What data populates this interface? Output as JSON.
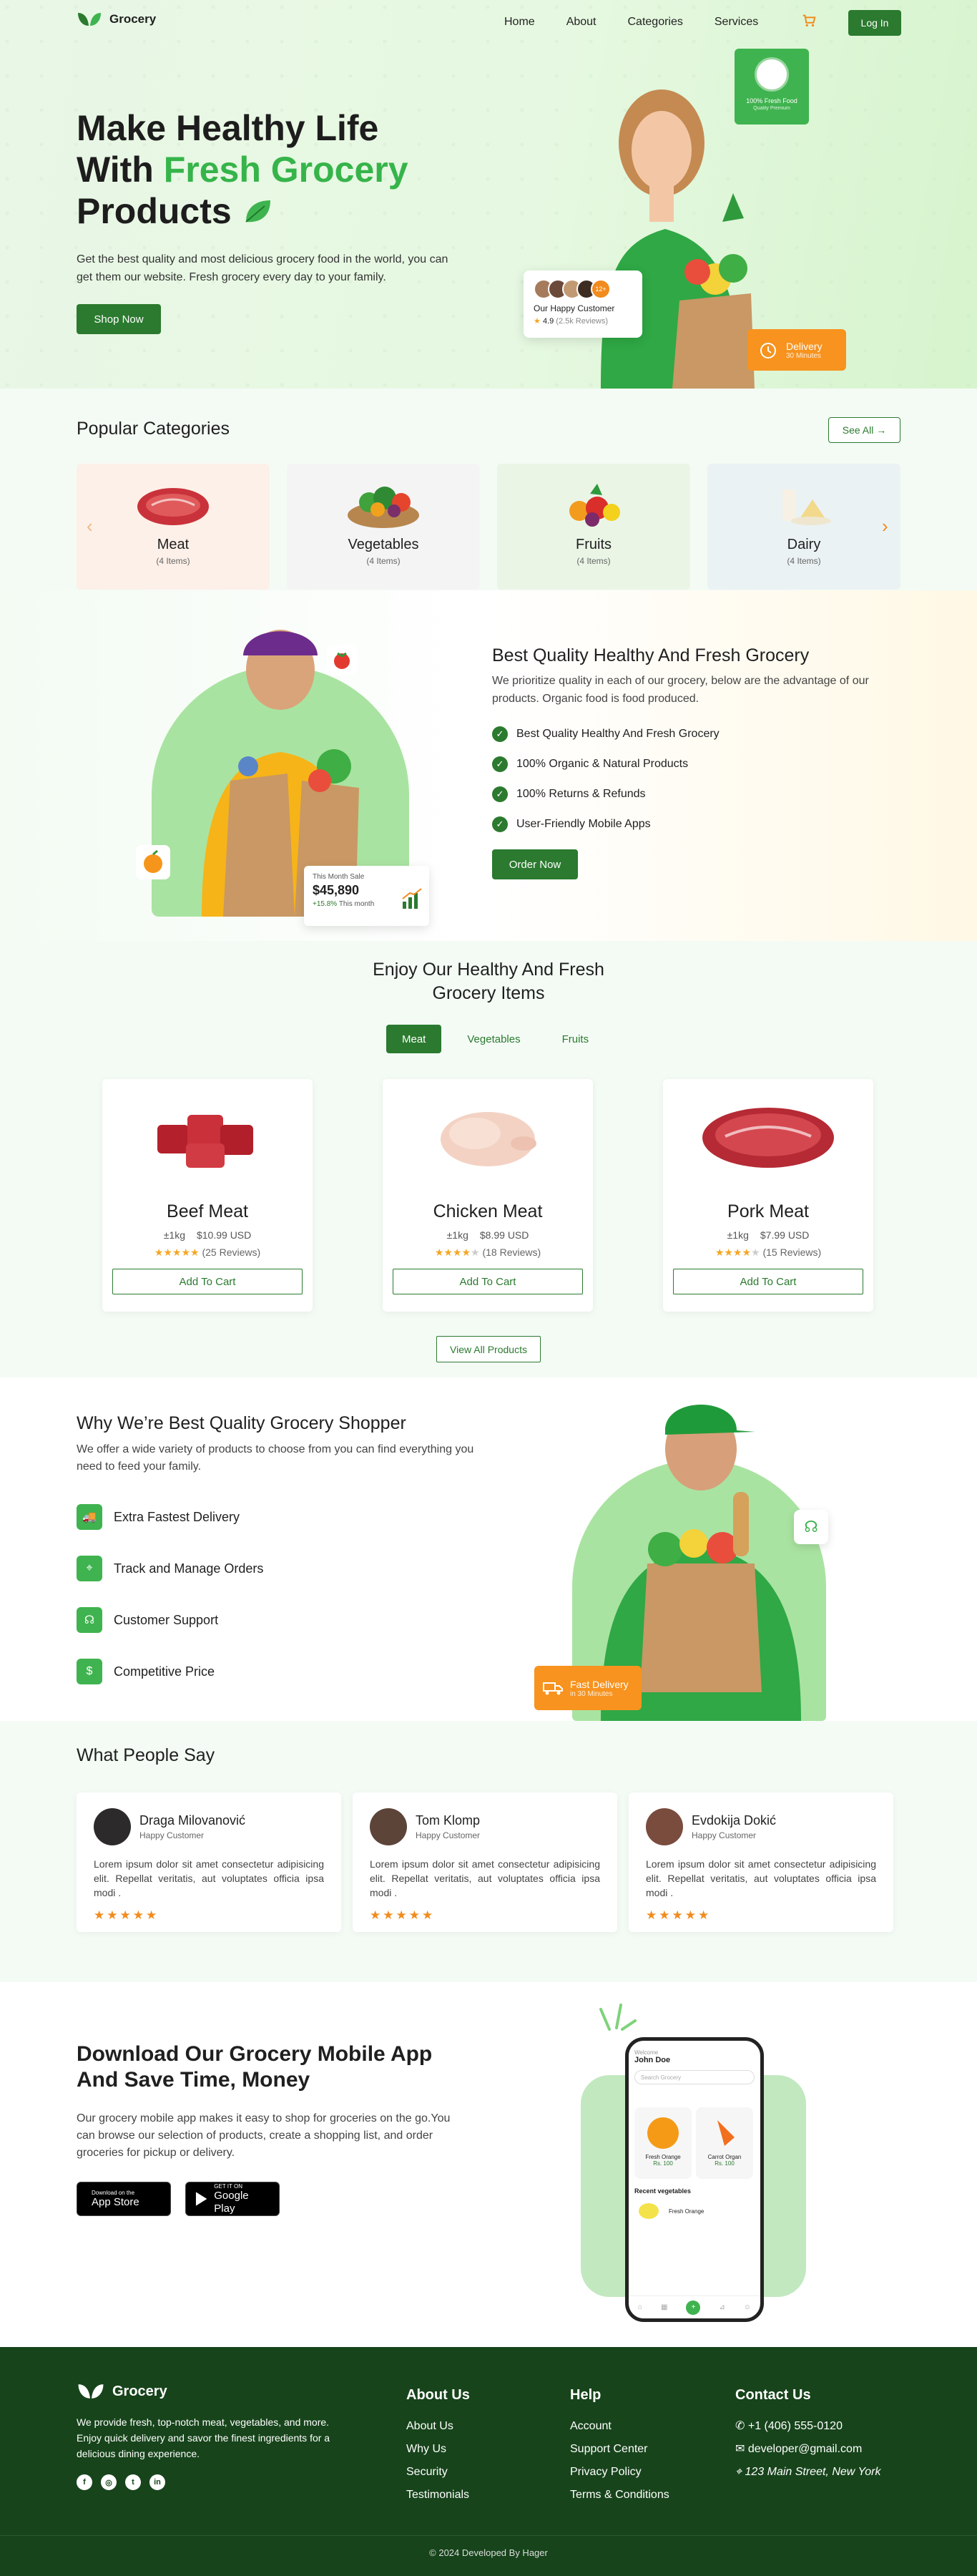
{
  "nav": {
    "brand": "Grocery",
    "links": [
      "Home",
      "About",
      "Categories",
      "Services"
    ],
    "login": "Log In",
    "accent": "#2b7a2f"
  },
  "hero": {
    "title_line1": "Make Healthy Life",
    "title_line2_a": "With ",
    "title_line2_b": "Fresh Grocery",
    "title_line3": "Products",
    "description": "Get the best quality and most delicious grocery food in the world, you can get them our website. Fresh grocery every day to your family.",
    "cta": "Shop Now",
    "badge": "100% Fresh Food",
    "badge_sub": "Quality Premium",
    "happy_title": "Our Happy Customer",
    "happy_more": "12+",
    "rating": "4.9",
    "reviews": "(2.5k Reviews)",
    "delivery": "Delivery",
    "delivery_sub": "30 Minutes"
  },
  "categories": {
    "title": "Popular Categories",
    "see_all": "See All",
    "items": [
      {
        "name": "Meat",
        "count": "(4 Items)",
        "bg": "#fdf0e8"
      },
      {
        "name": "Vegetables",
        "count": "(4 Items)",
        "bg": "#f4f4f4"
      },
      {
        "name": "Fruits",
        "count": "(4 Items)",
        "bg": "#eaf5e6"
      },
      {
        "name": "Dairy",
        "count": "(4 Items)",
        "bg": "#ebf2f3"
      }
    ]
  },
  "quality": {
    "title": "Best Quality Healthy And Fresh Grocery",
    "description": "We prioritize quality in each of our grocery, below are the advantage of our products. Organic food is food produced.",
    "points": [
      "Best Quality Healthy And Fresh Grocery",
      "100% Organic & Natural Products",
      "100% Returns & Refunds",
      "User-Friendly Mobile Apps"
    ],
    "cta": "Order Now",
    "sales_label": "This Month Sale",
    "sales_value": "$45,890",
    "sales_change": "+15.8%",
    "sales_change_label": "This month"
  },
  "products": {
    "title_line1": "Enjoy Our Healthy And Fresh",
    "title_line2": "Grocery Items",
    "tabs": [
      "Meat",
      "Vegetables",
      "Fruits"
    ],
    "items": [
      {
        "name": "Beef Meat",
        "weight": "±1kg",
        "price": "$10.99 USD",
        "reviews": "(25 Reviews)",
        "rating": 5
      },
      {
        "name": "Chicken Meat",
        "weight": "±1kg",
        "price": "$8.99 USD",
        "reviews": "(18 Reviews)",
        "rating": 4
      },
      {
        "name": "Pork Meat",
        "weight": "±1kg",
        "price": "$7.99 USD",
        "reviews": "(15 Reviews)",
        "rating": 4
      }
    ],
    "add_to_cart": "Add To Cart",
    "view_all": "View All Products"
  },
  "why": {
    "title": "Why We’re Best Quality Grocery Shopper",
    "description": "We offer a wide variety of products to choose from you can find everything you need to feed your family.",
    "items": [
      "Extra Fastest Delivery",
      "Track and Manage Orders",
      "Customer Support",
      "Competitive Price"
    ],
    "fast_title": "Fast Delivery",
    "fast_sub": "in 30 Minutes"
  },
  "testimonials": {
    "title": "What People Say",
    "items": [
      {
        "name": "Draga Milovanović",
        "role": "Happy Customer",
        "text": "Lorem ipsum dolor sit amet consectetur adipisicing elit. Repellat veritatis, aut voluptates officia ipsa modi ."
      },
      {
        "name": "Tom Klomp",
        "role": "Happy Customer",
        "text": "Lorem ipsum dolor sit amet consectetur adipisicing elit. Repellat veritatis, aut voluptates officia ipsa modi ."
      },
      {
        "name": "Evdokija Dokić",
        "role": "Happy Customer",
        "text": "Lorem ipsum dolor sit amet consectetur adipisicing elit. Repellat veritatis, aut voluptates officia ipsa modi ."
      }
    ]
  },
  "app": {
    "title": "Download Our Grocery Mobile App And Save Time, Money",
    "description": "Our grocery mobile app makes it easy to shop for groceries on the go.You can browse our selection of products, create a shopping list, and order groceries for pickup or delivery.",
    "appstore_small": "Download on the",
    "appstore": "App Store",
    "play_small": "GET IT ON",
    "play": "Google Play",
    "phone_user": "John Doe",
    "phone_search": "Search Grocery",
    "phone_item1": "Fresh Orange",
    "phone_item2": "Carrot Organ",
    "phone_price1": "Rs. 100",
    "phone_recent": "Recent vegetables"
  },
  "footer": {
    "brand": "Grocery",
    "description": "We provide fresh, top-notch meat, vegetables, and more. Enjoy quick delivery and savor the finest ingredients for a delicious dining experience.",
    "about_title": "About Us",
    "about_links": [
      "About Us",
      "Why Us",
      "Security",
      "Testimonials"
    ],
    "help_title": "Help",
    "help_links": [
      "Account",
      "Support Center",
      "Privacy Policy",
      "Terms & Conditions"
    ],
    "contact_title": "Contact Us",
    "phone": "+1 (406) 555-0120",
    "email": "developer@gmail.com",
    "address": "123 Main Street, New York",
    "copyright": "© 2024 Developed By Hager"
  }
}
